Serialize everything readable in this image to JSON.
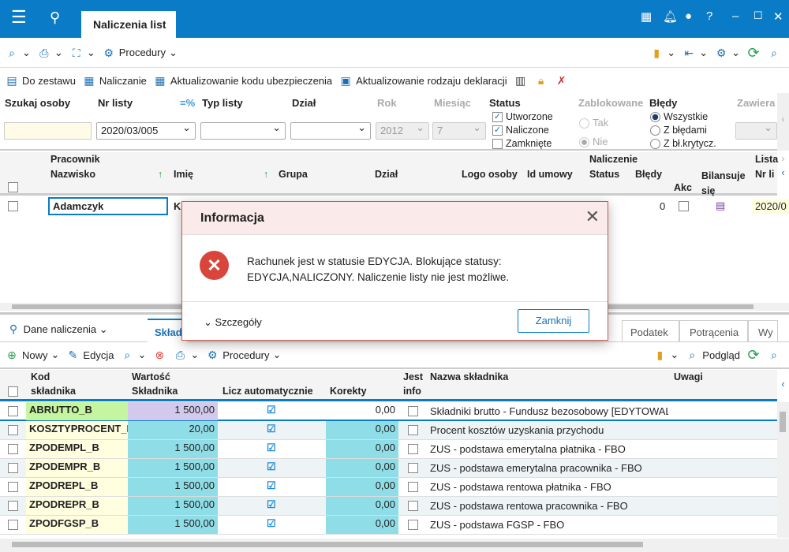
{
  "title_tab": "Naliczenia list",
  "toolbar1": {
    "procedury": "Procedury"
  },
  "toolbar2": {
    "do_zestawu": "Do zestawu",
    "naliczanie": "Naliczanie",
    "akt_kodu": "Aktualizowanie kodu ubezpieczenia",
    "akt_rodzaju": "Aktualizowanie rodzaju deklaracji"
  },
  "filters": {
    "szukaj": "Szukaj osoby",
    "nr_listy": "Nr listy",
    "nr_listy_value": "2020/03/005",
    "eq_pct": "=%",
    "typ_listy": "Typ listy",
    "dzial": "Dział",
    "rok": "Rok",
    "rok_value": "2012",
    "miesiac": "Miesiąc",
    "miesiac_value": "7",
    "status": "Status",
    "status_options": [
      "Utworzone",
      "Naliczone",
      "Zamknięte"
    ],
    "zablokowane": "Zablokowane",
    "tak": "Tak",
    "nie": "Nie",
    "bledy": "Błędy",
    "bledy_options": [
      "Wszystkie",
      "Z błędami",
      "Z bł.krytycz."
    ],
    "zawiera": "Zawiera"
  },
  "grid1": {
    "group_pracownik": "Pracownik",
    "group_naliczenie": "Naliczenie",
    "group_lista": "Lista",
    "cols": [
      "Nazwisko",
      "Imię",
      "Grupa",
      "Dział",
      "Logo osoby",
      "Id umowy",
      "Status",
      "Błędy",
      "Akc",
      "Bilansuje się",
      "Nr li"
    ],
    "row": {
      "nazwisko": "Adamczyk",
      "imie": "K",
      "bledy": "0",
      "nr": "2020/0"
    }
  },
  "dialog": {
    "title": "Informacja",
    "message": "Rachunek jest w statusie EDYCJA. Blokujące statusy: EDYCJA,NALICZONY. Naliczenie listy nie jest możliwe.",
    "details": "Szczegóły",
    "close": "Zamknij"
  },
  "bottom_tabs": {
    "dane": "Dane naliczenia",
    "active": "Skład",
    "tabs": [
      "Podatek",
      "Potrącenia",
      "Wy"
    ]
  },
  "toolbar3": {
    "nowy": "Nowy",
    "edycja": "Edycja",
    "procedury": "Procedury",
    "podglad": "Podgląd"
  },
  "grid2": {
    "cols": {
      "kod1": "Kod",
      "kod2": "składnika",
      "wartosc": "Wartość",
      "skladnika": "Składnika",
      "licz": "Licz automatycznie",
      "korekty": "Korekty",
      "jest1": "Jest",
      "jest2": "info",
      "nazwa": "Nazwa składnika",
      "uwagi": "Uwagi"
    },
    "rows": [
      {
        "kod": "ABRUTTO_B",
        "wartosc": "1 500,00",
        "auto": true,
        "korekty": "0,00",
        "nazwa": "Składniki brutto - Fundusz bezosobowy [EDYTOWAL"
      },
      {
        "kod": "KOSZTYPROCENT_B",
        "wartosc": "20,00",
        "auto": true,
        "korekty": "0,00",
        "nazwa": "Procent kosztów uzyskania przychodu"
      },
      {
        "kod": "ZPODEMPL_B",
        "wartosc": "1 500,00",
        "auto": true,
        "korekty": "0,00",
        "nazwa": "ZUS - podstawa emerytalna płatnika - FBO"
      },
      {
        "kod": "ZPODEMPR_B",
        "wartosc": "1 500,00",
        "auto": true,
        "korekty": "0,00",
        "nazwa": "ZUS - podstawa emerytalna pracownika - FBO"
      },
      {
        "kod": "ZPODREPL_B",
        "wartosc": "1 500,00",
        "auto": true,
        "korekty": "0,00",
        "nazwa": "ZUS - podstawa rentowa płatnika - FBO"
      },
      {
        "kod": "ZPODREPR_B",
        "wartosc": "1 500,00",
        "auto": true,
        "korekty": "0,00",
        "nazwa": "ZUS - podstawa rentowa pracownika - FBO"
      },
      {
        "kod": "ZPODFGSP_B",
        "wartosc": "1 500,00",
        "auto": true,
        "korekty": "0,00",
        "nazwa": "ZUS - podstawa FGSP - FBO"
      }
    ]
  },
  "colors": {
    "brand": "#0a7cc7",
    "dialog_border": "#c85a4a",
    "error": "#d9453a",
    "cyan": "#8fdde6",
    "green": "#c6f5a0",
    "lavender": "#d2c9ec",
    "yellow": "#ffffe0"
  }
}
